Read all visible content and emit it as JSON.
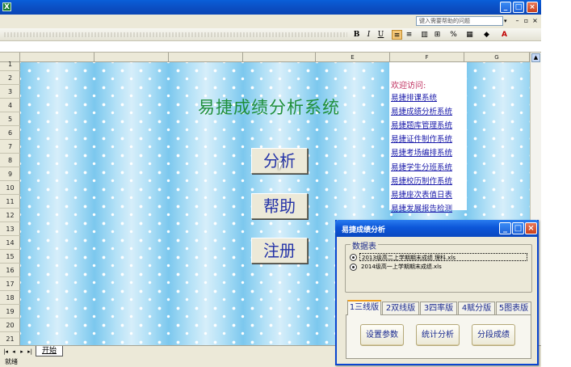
{
  "window": {
    "app_icon": "excel-icon",
    "help_search_placeholder": "键入需要帮助的问题",
    "caption_buttons": [
      "_",
      "□",
      "×"
    ]
  },
  "toolbar": {
    "bold": "B",
    "italic": "I",
    "underline": "U",
    "font_color_label": "A"
  },
  "columns": [
    "E",
    "F",
    "G"
  ],
  "rows": [
    "1",
    "2",
    "3",
    "4",
    "5",
    "6",
    "7",
    "8",
    "9",
    "10",
    "11",
    "12",
    "13",
    "14",
    "15",
    "16",
    "17",
    "18",
    "19",
    "20",
    "21"
  ],
  "sheet": {
    "title": "易捷成绩分析系统",
    "buttons": [
      "分析",
      "帮助",
      "注册"
    ],
    "welcome": "欢迎访问:",
    "links": [
      "易捷排课系统",
      "易捷成绩分析系统",
      "易捷题库管理系统",
      "易捷证件制作系统",
      "易捷考场编排系统",
      "易捷学生分班系统",
      "易捷校历制作系统",
      "易捷座次表值日表",
      "易捷发展报告检测"
    ],
    "tab_name": "开始",
    "status": "就绪"
  },
  "dialog": {
    "title": "易捷成绩分析",
    "group_label": "数据表",
    "files": [
      "2013级高二上学期期末成绩 理科.xls",
      "2014级高一上学期期末成绩.xls"
    ],
    "tabs": [
      "1三线版",
      "2双线版",
      "3四率版",
      "4赋分版",
      "5图表版"
    ],
    "selected_tab": 0,
    "actions": [
      "设置参数",
      "统计分析",
      "分段成绩"
    ]
  }
}
